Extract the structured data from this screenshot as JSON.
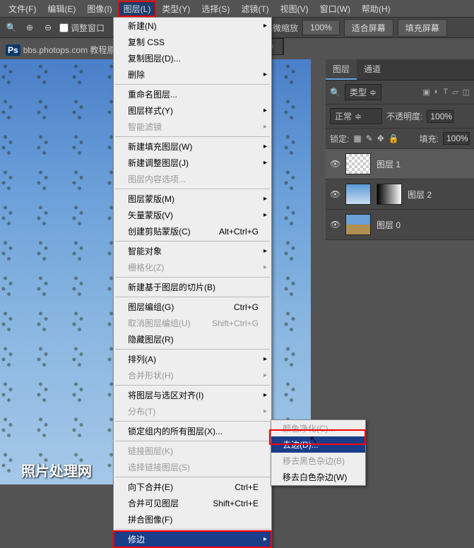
{
  "menubar": {
    "items": [
      "文件(F)",
      "编辑(E)",
      "图像(I)",
      "图层(L)",
      "类型(Y)",
      "选择(S)",
      "滤镜(T)",
      "视图(V)",
      "窗口(W)",
      "帮助(H)"
    ],
    "active_index": 3
  },
  "toolbar": {
    "checkbox_label": "调整窗口",
    "zoom_text": "细微缩放",
    "zoom_value": "100%",
    "fit_screen": "适合屏幕",
    "fill_screen": "填充屏幕"
  },
  "watermark": {
    "ps": "Ps",
    "text": "bbs.photops.com 教程原"
  },
  "tab": {
    "close": "×"
  },
  "canvas": {
    "footer": "照片处理网"
  },
  "menu": [
    {
      "label": "新建(N)",
      "arrow": true
    },
    {
      "label": "复制 CSS"
    },
    {
      "label": "复制图层(D)..."
    },
    {
      "label": "删除",
      "arrow": true
    },
    {
      "sep": true
    },
    {
      "label": "重命名图层..."
    },
    {
      "label": "图层样式(Y)",
      "arrow": true
    },
    {
      "label": "智能滤镜",
      "arrow": true,
      "disabled": true
    },
    {
      "sep": true
    },
    {
      "label": "新建填充图层(W)",
      "arrow": true
    },
    {
      "label": "新建调整图层(J)",
      "arrow": true
    },
    {
      "label": "图层内容选项...",
      "disabled": true
    },
    {
      "sep": true
    },
    {
      "label": "图层蒙版(M)",
      "arrow": true
    },
    {
      "label": "矢量蒙版(V)",
      "arrow": true
    },
    {
      "label": "创建剪贴蒙版(C)",
      "shortcut": "Alt+Ctrl+G"
    },
    {
      "sep": true
    },
    {
      "label": "智能对象",
      "arrow": true
    },
    {
      "label": "栅格化(Z)",
      "arrow": true,
      "disabled": true
    },
    {
      "sep": true
    },
    {
      "label": "新建基于图层的切片(B)"
    },
    {
      "sep": true
    },
    {
      "label": "图层编组(G)",
      "shortcut": "Ctrl+G"
    },
    {
      "label": "取消图层编组(U)",
      "shortcut": "Shift+Ctrl+G",
      "disabled": true
    },
    {
      "label": "隐藏图层(R)"
    },
    {
      "sep": true
    },
    {
      "label": "排列(A)",
      "arrow": true
    },
    {
      "label": "合并形状(H)",
      "arrow": true,
      "disabled": true
    },
    {
      "sep": true
    },
    {
      "label": "将图层与选区对齐(I)",
      "arrow": true
    },
    {
      "label": "分布(T)",
      "arrow": true,
      "disabled": true
    },
    {
      "sep": true
    },
    {
      "label": "锁定组内的所有图层(X)..."
    },
    {
      "sep": true
    },
    {
      "label": "链接图层(K)",
      "disabled": true
    },
    {
      "label": "选择链接图层(S)",
      "disabled": true
    },
    {
      "sep": true
    },
    {
      "label": "向下合并(E)",
      "shortcut": "Ctrl+E"
    },
    {
      "label": "合并可见图层",
      "shortcut": "Shift+Ctrl+E"
    },
    {
      "label": "拼合图像(F)"
    },
    {
      "sep": true
    },
    {
      "label": "修边",
      "arrow": true,
      "hl": true,
      "boxed": true
    }
  ],
  "submenu": [
    {
      "label": "颜色净化(C)...",
      "disabled": true
    },
    {
      "label": "去边(D)...",
      "hl": true
    },
    {
      "label": "移去黑色杂边(B)",
      "disabled": true
    },
    {
      "label": "移去白色杂边(W)"
    }
  ],
  "panels": {
    "tabs": [
      "图层",
      "通道"
    ],
    "type_label": "类型",
    "blend_mode": "正常",
    "opacity_label": "不透明度:",
    "opacity_value": "100%",
    "lock_label": "锁定:",
    "fill_label": "填充:",
    "fill_value": "100%",
    "layers": [
      {
        "name": "图层 1",
        "thumb": "checker"
      },
      {
        "name": "图层 2",
        "thumb": "sky",
        "mask": "grad"
      },
      {
        "name": "图层 0",
        "thumb": "photo"
      }
    ]
  }
}
